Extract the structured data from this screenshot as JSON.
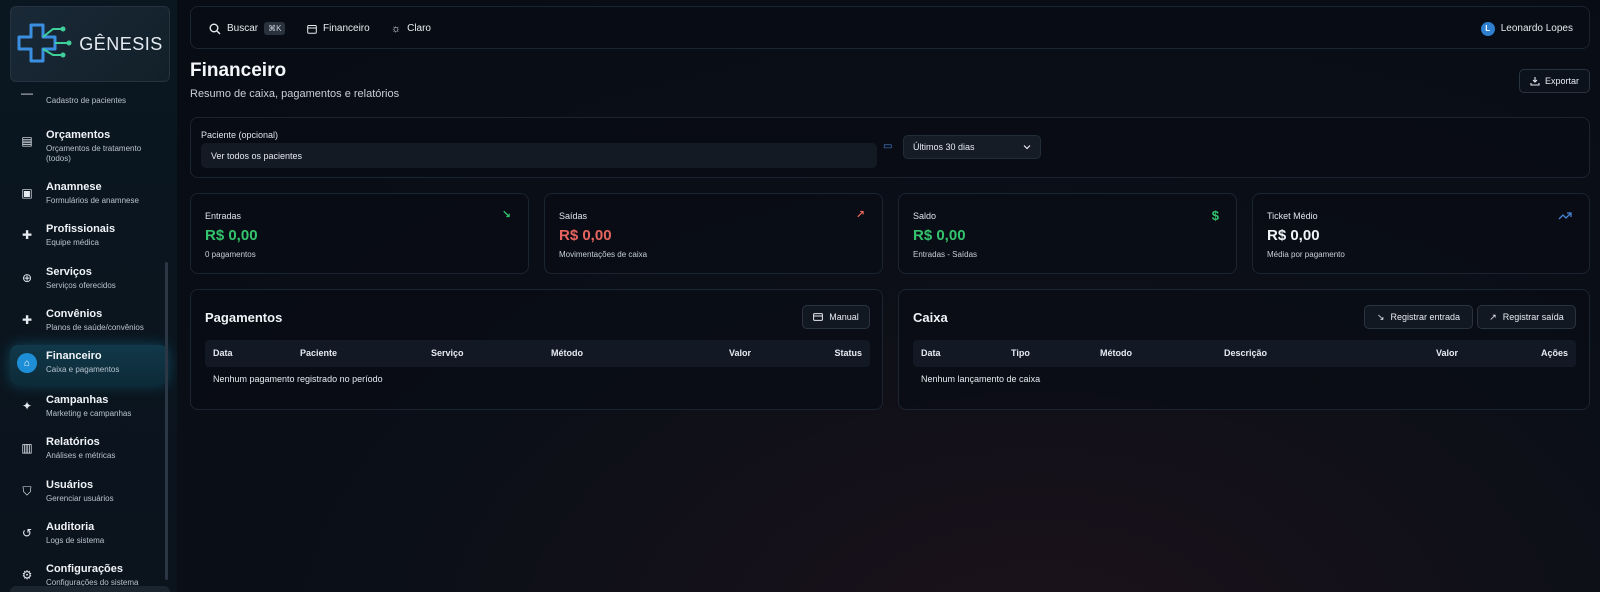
{
  "app": {
    "logo_text": "GÊNESIS"
  },
  "topbar": {
    "search_label": "Buscar",
    "search_shortcut": "⌘K",
    "section_label": "Financeiro",
    "theme_label": "Claro",
    "user_initial": "L",
    "user_name": "Leonardo Lopes"
  },
  "sidebar": {
    "items": [
      {
        "title": "",
        "subtitle": "Cadastro de pacientes",
        "icon": "minus-icon"
      },
      {
        "title": "Orçamentos",
        "subtitle": "Orçamentos de tratamento (todos)",
        "icon": "receipt-icon"
      },
      {
        "title": "Anamnese",
        "subtitle": "Formulários de anamnese",
        "icon": "clipboard-icon"
      },
      {
        "title": "Profissionais",
        "subtitle": "Equipe médica",
        "icon": "medical-cross-icon"
      },
      {
        "title": "Serviços",
        "subtitle": "Serviços oferecidos",
        "icon": "medical-bag-icon"
      },
      {
        "title": "Convênios",
        "subtitle": "Planos de saúde/convênios",
        "icon": "medical-cross-icon"
      },
      {
        "title": "Financeiro",
        "subtitle": "Caixa e pagamentos",
        "icon": "bank-icon"
      },
      {
        "title": "Campanhas",
        "subtitle": "Marketing e campanhas",
        "icon": "sparkles-icon"
      },
      {
        "title": "Relatórios",
        "subtitle": "Análises e métricas",
        "icon": "bar-chart-icon"
      },
      {
        "title": "Usuários",
        "subtitle": "Gerenciar usuários",
        "icon": "shield-user-icon"
      },
      {
        "title": "Auditoria",
        "subtitle": "Logs de sistema",
        "icon": "history-icon"
      },
      {
        "title": "Configurações",
        "subtitle": "Configurações do sistema",
        "icon": "gear-icon"
      }
    ]
  },
  "header": {
    "title": "Financeiro",
    "subtitle": "Resumo de caixa, pagamentos e relatórios",
    "export_label": "Exportar"
  },
  "filter": {
    "patient_label": "Paciente (opcional)",
    "patient_value": "Ver todos os pacientes",
    "period_value": "Últimos 30 dias"
  },
  "stats": [
    {
      "label": "Entradas",
      "value": "R$ 0,00",
      "sub": "0 pagamentos",
      "icon": "arrow-down-right-icon",
      "color": "#34c46e"
    },
    {
      "label": "Saídas",
      "value": "R$ 0,00",
      "sub": "Movimentações de caixa",
      "icon": "arrow-up-right-icon",
      "color": "#e8655f"
    },
    {
      "label": "Saldo",
      "value": "R$ 0,00",
      "sub": "Entradas - Saídas",
      "icon": "dollar-icon",
      "color": "#34c46e"
    },
    {
      "label": "Ticket Médio",
      "value": "R$ 0,00",
      "sub": "Média por pagamento",
      "icon": "trending-up-icon",
      "color": "#f0f3f7"
    }
  ],
  "payments": {
    "title": "Pagamentos",
    "manual_label": "Manual",
    "columns": [
      "Data",
      "Paciente",
      "Serviço",
      "Método",
      "Valor",
      "Status"
    ],
    "empty": "Nenhum pagamento registrado no período"
  },
  "cash": {
    "title": "Caixa",
    "entry_label": "Registrar entrada",
    "exit_label": "Registrar saída",
    "columns": [
      "Data",
      "Tipo",
      "Método",
      "Descrição",
      "Valor",
      "Ações"
    ],
    "empty": "Nenhum lançamento de caixa"
  }
}
